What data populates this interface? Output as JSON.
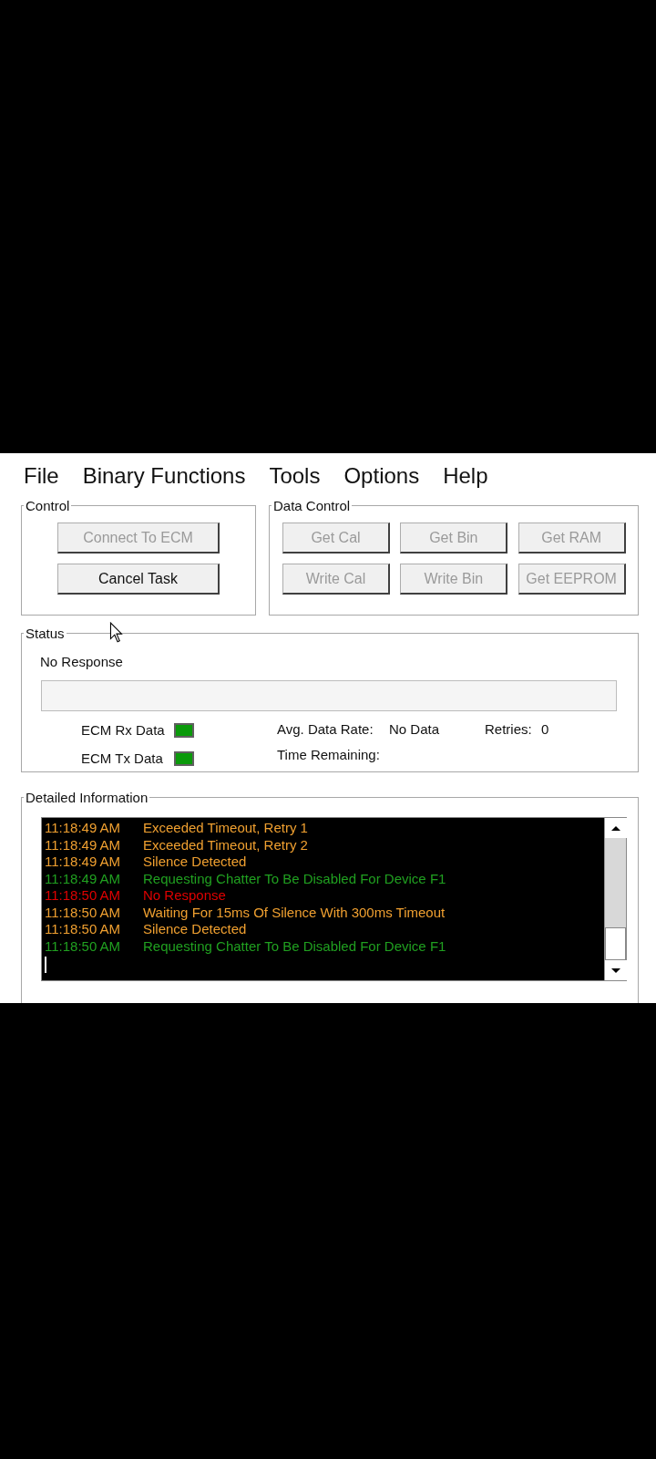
{
  "menu": [
    {
      "label": "File"
    },
    {
      "label": "Binary Functions"
    },
    {
      "label": "Tools"
    },
    {
      "label": "Options"
    },
    {
      "label": "Help"
    }
  ],
  "control": {
    "title": "Control",
    "buttons": [
      {
        "label": "Connect To ECM",
        "disabled": true
      },
      {
        "label": "Cancel Task",
        "disabled": false
      }
    ]
  },
  "data_control": {
    "title": "Data Control",
    "buttons": [
      {
        "label": "Get Cal",
        "disabled": true
      },
      {
        "label": "Get Bin",
        "disabled": true
      },
      {
        "label": "Get RAM",
        "disabled": true
      },
      {
        "label": "Write Cal",
        "disabled": true
      },
      {
        "label": "Write Bin",
        "disabled": true
      },
      {
        "label": "Get EEPROM",
        "disabled": true
      }
    ]
  },
  "status": {
    "title": "Status",
    "message": "No Response",
    "progress": {
      "level": 0
    },
    "indicators": [
      {
        "label": "ECM Rx Data",
        "on": true
      },
      {
        "label": "ECM Tx Data",
        "on": true
      }
    ],
    "avg_rate_label": "Avg. Data Rate:",
    "avg_rate_value": "No Data",
    "retries_label": "Retries:",
    "retries_value": "0",
    "time_remaining_label": "Time Remaining:"
  },
  "detailed_information": {
    "title": "Detailed Information",
    "log": [
      {
        "time": "11:18:49 AM",
        "message": "Exceeded Timeout, Retry 1",
        "color": "#f0a030"
      },
      {
        "time": "11:18:49 AM",
        "message": "Exceeded Timeout, Retry 2",
        "color": "#f0a030"
      },
      {
        "time": "11:18:49 AM",
        "message": "Silence Detected",
        "color": "#f0a030"
      },
      {
        "time": "11:18:49 AM",
        "message": "Requesting Chatter To Be Disabled For Device F1",
        "color": "#20a020"
      },
      {
        "time": "11:18:50 AM",
        "message": "No Response",
        "color": "#e00000"
      },
      {
        "time": "11:18:50 AM",
        "message": "Waiting For 15ms Of Silence With 300ms Timeout",
        "color": "#f0a030"
      },
      {
        "time": "11:18:50 AM",
        "message": "Silence Detected",
        "color": "#f0a030"
      },
      {
        "time": "11:18:50 AM",
        "message": "Requesting Chatter To Be Disabled For Device F1",
        "color": "#20a020"
      }
    ]
  }
}
